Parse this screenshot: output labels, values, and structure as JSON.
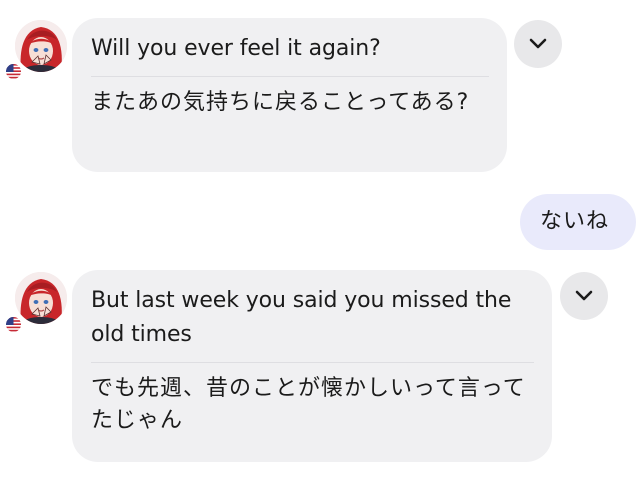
{
  "messages": [
    {
      "sender": "incoming",
      "flag_icon": "us-flag-icon",
      "text": "Will you ever feel it again?",
      "translation": "またあの気持ちに戻ることってある?",
      "menu_icon": "chevron-down-icon"
    },
    {
      "sender": "outgoing",
      "text": "ないね"
    },
    {
      "sender": "incoming",
      "flag_icon": "us-flag-icon",
      "text": "But last week you said you missed the old times",
      "translation": "でも先週、昔のことが懐かしいって言ってたじゃん",
      "menu_icon": "chevron-down-icon"
    }
  ],
  "colors": {
    "incoming_bubble": "#f0f0f2",
    "outgoing_bubble": "#e9eafb",
    "chevron_button": "#e8e8ea",
    "avatar_hair": "#c8262a"
  }
}
